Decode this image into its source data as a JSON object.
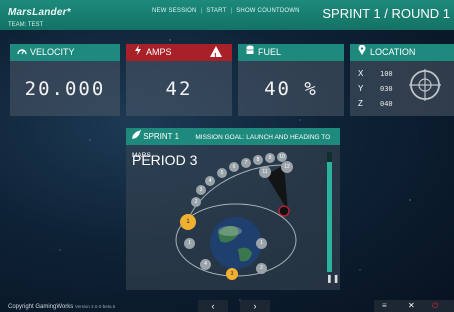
{
  "app": {
    "brand": "MarsLander*",
    "team": "TEAM: TEST",
    "nav": [
      "NEW SESSION",
      "START",
      "SHOW COUNTDOWN"
    ],
    "round_title": "SPRINT 1 / ROUND 1"
  },
  "panels": {
    "velocity": {
      "label": "VELOCITY",
      "value": "20.000",
      "icon": "gauge-icon"
    },
    "amps": {
      "label": "AMPS",
      "value": "42",
      "icon": "bolt-icon",
      "warning_icon": "warning-icon"
    },
    "fuel": {
      "label": "FUEL",
      "value": "40 %",
      "icon": "database-icon"
    },
    "location": {
      "label": "LOCATION",
      "icon": "map-pin-icon",
      "x_label": "X",
      "x_value": "100",
      "y_label": "Y",
      "y_value": "030",
      "z_label": "Z",
      "z_value": "040"
    }
  },
  "mission": {
    "sprint_label": "SPRINT 1",
    "goal": "MISSION GOAL: LAUNCH AND HEADING TO MARS",
    "period": "PERIOD 3",
    "progress_fraction": 0.92,
    "pause_icon": "pause-icon",
    "orbit_numbers": [
      "1",
      "2",
      "3",
      "4",
      "5",
      "6",
      "7",
      "8",
      "9",
      "10",
      "11",
      "12"
    ],
    "orbit_low": [
      "1",
      "3",
      "4",
      "5",
      "6",
      "1",
      "2"
    ]
  },
  "footer": {
    "copyright": "Copyright GamingWorks",
    "version": "Version 2.0.0-beta.5",
    "prev_label": "‹",
    "next_label": "›"
  },
  "colors": {
    "teal": "#1e8a7d",
    "red": "#a82128",
    "orange": "#f0b030"
  }
}
